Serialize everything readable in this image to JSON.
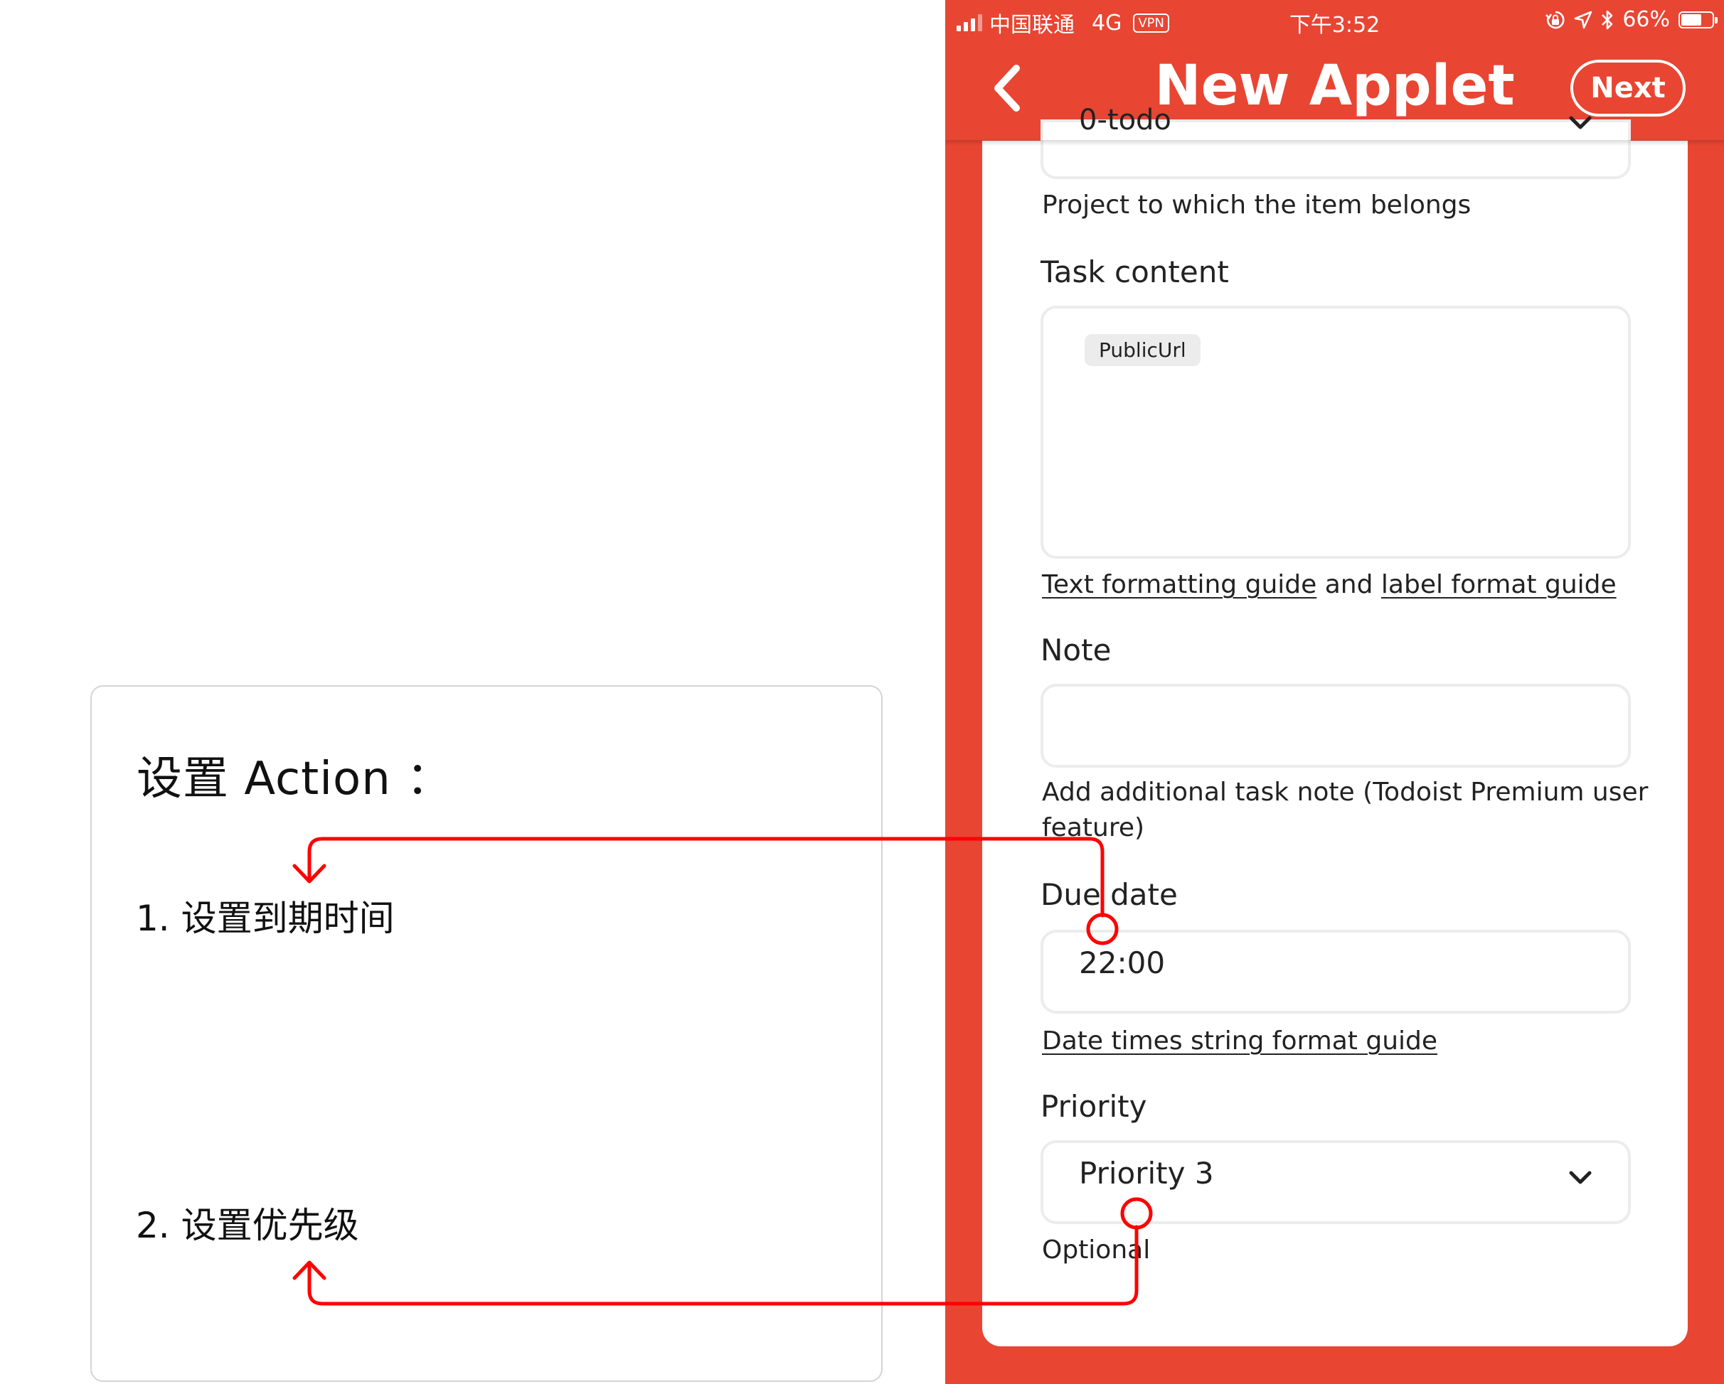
{
  "annotation": {
    "title": "设置 Action ：",
    "step1": "1. 设置到期时间",
    "step2": "2. 设置优先级"
  },
  "status_bar": {
    "carrier": "中国联通",
    "network": "4G",
    "vpn": "VPN",
    "time": "下午3:52",
    "battery": "66%",
    "battery_level": 0.66
  },
  "nav": {
    "title": "New Applet",
    "next_label": "Next"
  },
  "form": {
    "project_value": "0-todo",
    "project_help": "Project to which the item belongs",
    "task_content_label": "Task content",
    "task_content_chip": "PublicUrl",
    "text_formatting_link": "Text formatting guide",
    "and_text": "and",
    "label_format_link": "label format guide",
    "note_label": "Note",
    "note_value": "",
    "note_help_line1": "Add additional task note (Todoist Premium user",
    "note_help_line2": "feature)",
    "due_date_label": "Due date",
    "due_date_value": "22:00",
    "date_guide_link": "Date times string format guide",
    "priority_label": "Priority",
    "priority_value": "Priority 3",
    "priority_help": "Optional"
  },
  "colors": {
    "brand_red": "#e84533",
    "annotation_red": "#ff0000"
  },
  "icons": [
    "back-chevron-icon",
    "chevron-down-icon",
    "signal-icon",
    "lock-rotation-icon",
    "location-arrow-icon",
    "bluetooth-icon",
    "battery-icon"
  ]
}
